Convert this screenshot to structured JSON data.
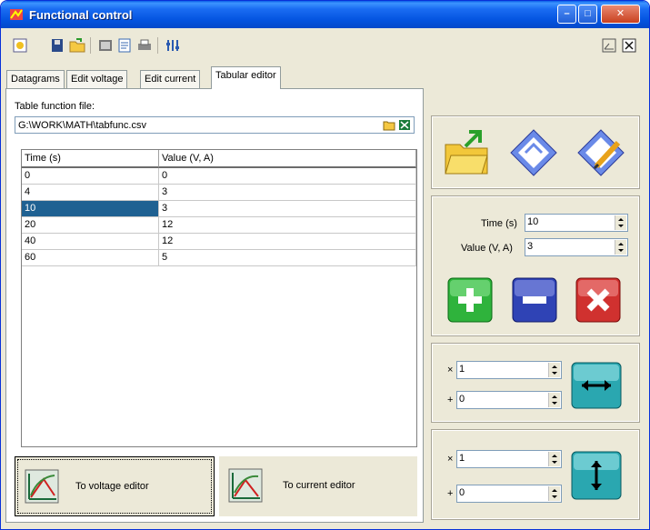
{
  "window": {
    "title": "Functional control",
    "controls": [
      "minimize",
      "maximize",
      "close"
    ]
  },
  "toolbar": {
    "tools": [
      "new-icon",
      "save-icon",
      "open-icon",
      "preview-icon",
      "page-icon",
      "print-icon",
      "settings-icon"
    ],
    "right_tools": [
      "restore-icon",
      "close-icon"
    ]
  },
  "tabs": [
    {
      "label": "Datagrams",
      "active": false
    },
    {
      "label": "Edit voltage",
      "active": false
    },
    {
      "label": "Edit current",
      "active": false
    },
    {
      "label": "Tabular editor",
      "active": true
    }
  ],
  "file": {
    "label": "Table function file:",
    "value": "G:\\WORK\\MATH\\tabfunc.csv"
  },
  "table": {
    "columns": [
      "Time (s)",
      "Value (V, A)"
    ],
    "rows": [
      [
        "0",
        "0"
      ],
      [
        "4",
        "3"
      ],
      [
        "10",
        "3"
      ],
      [
        "20",
        "12"
      ],
      [
        "40",
        "12"
      ],
      [
        "60",
        "5"
      ]
    ],
    "selected_row": 2
  },
  "bottom_buttons": {
    "voltage": "To voltage editor",
    "current": "To current editor"
  },
  "editor": {
    "time_label": "Time (s)",
    "time_value": "10",
    "value_label": "Value (V, A)",
    "value_value": "3"
  },
  "scale_x": {
    "mul_op": "×",
    "mul_value": "1",
    "add_op": "+",
    "add_value": "0"
  },
  "scale_y": {
    "mul_op": "×",
    "mul_value": "1",
    "add_op": "+",
    "add_value": "0"
  },
  "colors": {
    "titlebar": "#0454e0",
    "selection": "#1f6192",
    "add_button": "#2fb33c",
    "remove_button": "#2f43b5",
    "delete_button": "#d0312f",
    "scale_button": "#2aa7b0"
  }
}
